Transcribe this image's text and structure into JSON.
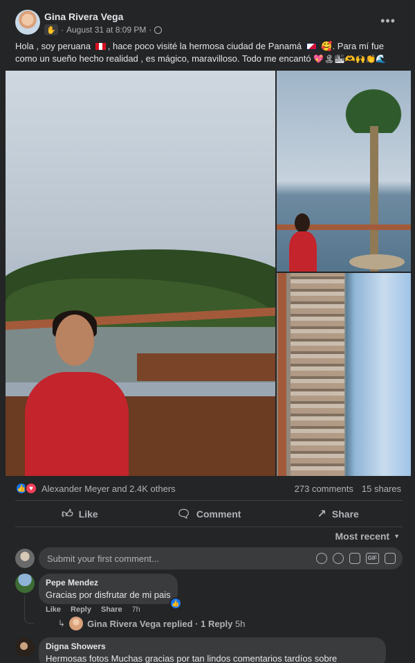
{
  "post": {
    "author": "Gina Rivera Vega",
    "timestamp": "August 31 at 8:09 PM",
    "meta_sep": "·",
    "text_part1": "Hola , soy peruana ",
    "text_part2": ", hace poco visité la hermosa ciudad de Panamá ",
    "text_part3": " 🥰. Para mí fue como un sueño hecho realidad , es mágico, maravilloso.  Todo me encantó ",
    "text_emojis": "💖🏝🏙🫶🙌👏🌊",
    "more_icon": "•••"
  },
  "reactions": {
    "summary": "Alexander Meyer and 2.4K others",
    "comments_count": "273 comments",
    "shares_count": "15 shares"
  },
  "actions": {
    "like": "Like",
    "comment": "Comment",
    "share": "Share"
  },
  "sort": {
    "label": "Most recent"
  },
  "composer": {
    "placeholder": "Submit your first comment...",
    "gif_label": "GIF"
  },
  "comments": [
    {
      "name": "Pepe Mendez",
      "text": "Gracias por disfrutar de mi pais",
      "like": "Like",
      "reply": "Reply",
      "share": "Share",
      "time": "7h",
      "reply_author": "Gina Rivera Vega replied",
      "reply_count": "· 1 Reply",
      "reply_time": "5h"
    },
    {
      "name": "Digna Showers",
      "text": "Hermosas fotos Muchas gracias por tan lindos comentarios tardíos sobre"
    }
  ],
  "colors": {
    "background": "#242526",
    "text": "#e4e6eb",
    "secondary_text": "#b0b3b8",
    "bubble": "#3a3b3c",
    "like_blue": "#1877f2",
    "love_red": "#f33e58"
  }
}
